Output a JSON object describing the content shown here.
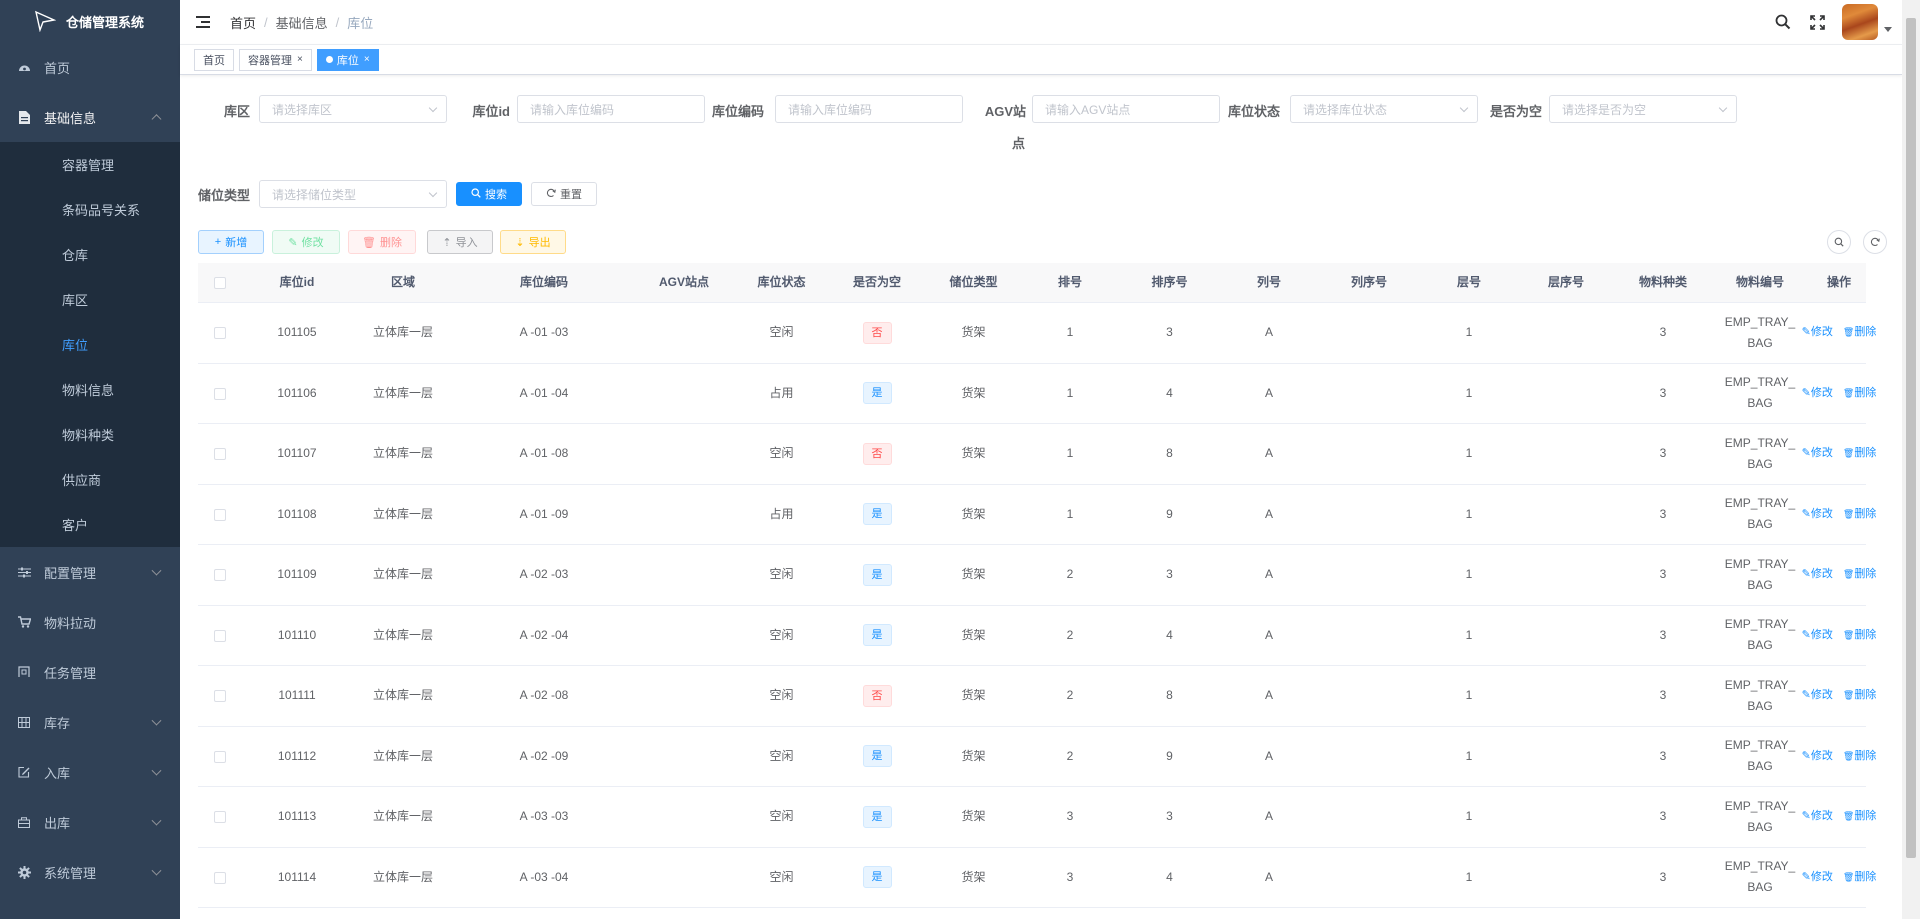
{
  "app": {
    "title": "仓储管理系统"
  },
  "sidebar": {
    "items": [
      {
        "label": "首页",
        "icon": "dashboard-icon"
      },
      {
        "label": "基础信息",
        "icon": "document-icon"
      },
      {
        "label": "配置管理",
        "icon": "sliders-icon"
      },
      {
        "label": "物料拉动",
        "icon": "cart-icon"
      },
      {
        "label": "任务管理",
        "icon": "task-icon"
      },
      {
        "label": "库存",
        "icon": "grid-icon"
      },
      {
        "label": "入库",
        "icon": "edit-icon"
      },
      {
        "label": "出库",
        "icon": "box-icon"
      },
      {
        "label": "系统管理",
        "icon": "gear-icon"
      }
    ],
    "sub_items": [
      {
        "label": "容器管理"
      },
      {
        "label": "条码品号关系"
      },
      {
        "label": "仓库"
      },
      {
        "label": "库区"
      },
      {
        "label": "库位"
      },
      {
        "label": "物料信息"
      },
      {
        "label": "物料种类"
      },
      {
        "label": "供应商"
      },
      {
        "label": "客户"
      }
    ]
  },
  "breadcrumb": [
    "首页",
    "基础信息",
    "库位"
  ],
  "tags": [
    {
      "label": "首页"
    },
    {
      "label": "容器管理"
    },
    {
      "label": "库位"
    }
  ],
  "form": {
    "area_label": "库区",
    "area_placeholder": "请选择库区",
    "id_label": "库位id",
    "id_placeholder": "请输入库位编码",
    "code_label": "库位编码",
    "code_placeholder": "请输入库位编码",
    "agv_label_1": "AGV站",
    "agv_label_2": "点",
    "agv_placeholder": "请输入AGV站点",
    "status_label": "库位状态",
    "status_placeholder": "请选择库位状态",
    "empty_label": "是否为空",
    "empty_placeholder": "请选择是否为空",
    "type_label": "储位类型",
    "type_placeholder": "请选择储位类型",
    "search_btn": "搜索",
    "reset_btn": "重置"
  },
  "toolbar": {
    "add": "新增",
    "edit": "修改",
    "delete": "删除",
    "import": "导入",
    "export": "导出"
  },
  "table": {
    "columns": [
      "库位id",
      "区域",
      "库位编码",
      "AGV站点",
      "库位状态",
      "是否为空",
      "储位类型",
      "排号",
      "排序号",
      "列号",
      "列序号",
      "层号",
      "层序号",
      "物料种类",
      "物料编号",
      "操作"
    ],
    "edit_label": "修改",
    "delete_label": "删除",
    "rows": [
      {
        "id": "101105",
        "area": "立体库一层",
        "code": "A -01 -03",
        "agv": "",
        "status": "空闲",
        "empty": "否",
        "type": "货架",
        "row": "1",
        "row_seq": "3",
        "col": "A",
        "col_seq": "",
        "layer": "1",
        "layer_seq": "",
        "kind": "3",
        "material_1": "EMP_TRAY_",
        "material_2": "BAG"
      },
      {
        "id": "101106",
        "area": "立体库一层",
        "code": "A -01 -04",
        "agv": "",
        "status": "占用",
        "empty": "是",
        "type": "货架",
        "row": "1",
        "row_seq": "4",
        "col": "A",
        "col_seq": "",
        "layer": "1",
        "layer_seq": "",
        "kind": "3",
        "material_1": "EMP_TRAY_",
        "material_2": "BAG"
      },
      {
        "id": "101107",
        "area": "立体库一层",
        "code": "A -01 -08",
        "agv": "",
        "status": "空闲",
        "empty": "否",
        "type": "货架",
        "row": "1",
        "row_seq": "8",
        "col": "A",
        "col_seq": "",
        "layer": "1",
        "layer_seq": "",
        "kind": "3",
        "material_1": "EMP_TRAY_",
        "material_2": "BAG"
      },
      {
        "id": "101108",
        "area": "立体库一层",
        "code": "A -01 -09",
        "agv": "",
        "status": "占用",
        "empty": "是",
        "type": "货架",
        "row": "1",
        "row_seq": "9",
        "col": "A",
        "col_seq": "",
        "layer": "1",
        "layer_seq": "",
        "kind": "3",
        "material_1": "EMP_TRAY_",
        "material_2": "BAG"
      },
      {
        "id": "101109",
        "area": "立体库一层",
        "code": "A -02 -03",
        "agv": "",
        "status": "空闲",
        "empty": "是",
        "type": "货架",
        "row": "2",
        "row_seq": "3",
        "col": "A",
        "col_seq": "",
        "layer": "1",
        "layer_seq": "",
        "kind": "3",
        "material_1": "EMP_TRAY_",
        "material_2": "BAG"
      },
      {
        "id": "101110",
        "area": "立体库一层",
        "code": "A -02 -04",
        "agv": "",
        "status": "空闲",
        "empty": "是",
        "type": "货架",
        "row": "2",
        "row_seq": "4",
        "col": "A",
        "col_seq": "",
        "layer": "1",
        "layer_seq": "",
        "kind": "3",
        "material_1": "EMP_TRAY_",
        "material_2": "BAG"
      },
      {
        "id": "101111",
        "area": "立体库一层",
        "code": "A -02 -08",
        "agv": "",
        "status": "空闲",
        "empty": "否",
        "type": "货架",
        "row": "2",
        "row_seq": "8",
        "col": "A",
        "col_seq": "",
        "layer": "1",
        "layer_seq": "",
        "kind": "3",
        "material_1": "EMP_TRAY_",
        "material_2": "BAG"
      },
      {
        "id": "101112",
        "area": "立体库一层",
        "code": "A -02 -09",
        "agv": "",
        "status": "空闲",
        "empty": "是",
        "type": "货架",
        "row": "2",
        "row_seq": "9",
        "col": "A",
        "col_seq": "",
        "layer": "1",
        "layer_seq": "",
        "kind": "3",
        "material_1": "EMP_TRAY_",
        "material_2": "BAG"
      },
      {
        "id": "101113",
        "area": "立体库一层",
        "code": "A -03 -03",
        "agv": "",
        "status": "空闲",
        "empty": "是",
        "type": "货架",
        "row": "3",
        "row_seq": "3",
        "col": "A",
        "col_seq": "",
        "layer": "1",
        "layer_seq": "",
        "kind": "3",
        "material_1": "EMP_TRAY_",
        "material_2": "BAG"
      },
      {
        "id": "101114",
        "area": "立体库一层",
        "code": "A -03 -04",
        "agv": "",
        "status": "空闲",
        "empty": "是",
        "type": "货架",
        "row": "3",
        "row_seq": "4",
        "col": "A",
        "col_seq": "",
        "layer": "1",
        "layer_seq": "",
        "kind": "3",
        "material_1": "EMP_TRAY_",
        "material_2": "BAG"
      }
    ]
  },
  "colors": {
    "sidebar_bg": "#304156",
    "submenu_bg": "#1f2d3d",
    "accent": "#409eff",
    "primary": "#1890ff",
    "danger": "#ff4949"
  }
}
